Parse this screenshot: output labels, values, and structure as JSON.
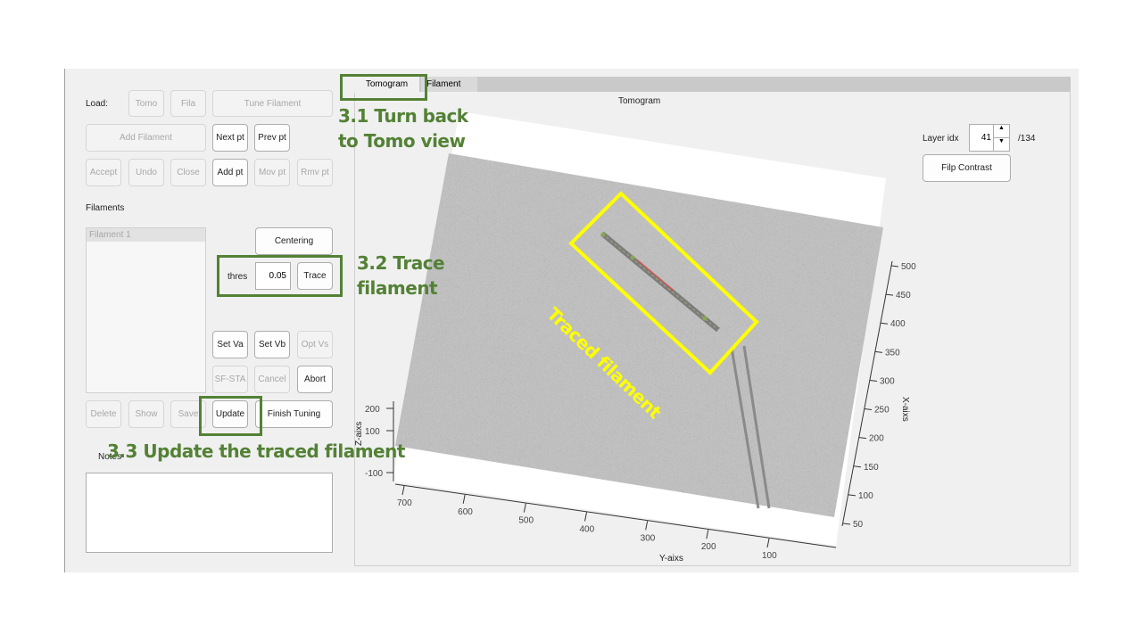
{
  "load_panel": {
    "load_label": "Load:",
    "tomo": "Tomo",
    "fila": "Fila",
    "tune_filament": "Tune Filament",
    "add_filament": "Add Filament",
    "next_pt": "Next pt",
    "prev_pt": "Prev pt",
    "accept": "Accept",
    "undo": "Undo",
    "close": "Close",
    "add_pt": "Add pt",
    "mov_pt": "Mov pt",
    "rmv_pt": "Rmv pt"
  },
  "filaments": {
    "label": "Filaments",
    "items": [
      "Filament 1"
    ],
    "centering": "Centering",
    "thres_label": "thres",
    "thres_value": "0.05",
    "trace": "Trace",
    "set_va": "Set Va",
    "set_vb": "Set Vb",
    "opt_vs": "Opt Vs",
    "sf_sta": "SF-STA",
    "cancel": "Cancel",
    "abort": "Abort",
    "delete": "Delete",
    "show": "Show",
    "save": "Save",
    "update": "Update",
    "finish_tuning": "Finish Tuning"
  },
  "notes": {
    "label": "Notes",
    "value": ""
  },
  "tabs": [
    {
      "label": "Tomogram",
      "active": true
    },
    {
      "label": "Filament",
      "active": false
    }
  ],
  "tomogram": {
    "title": "Tomogram",
    "layer_label": "Layer idx",
    "layer_value": "41",
    "layer_total": "/134",
    "flip_contrast": "Filp Contrast",
    "x_axis": {
      "label": "X-aixs",
      "ticks": [
        "500",
        "450",
        "400",
        "350",
        "300",
        "250",
        "200",
        "150",
        "100",
        "50"
      ]
    },
    "y_axis": {
      "label": "Y-aixs",
      "ticks": [
        "700",
        "600",
        "500",
        "400",
        "300",
        "200",
        "100"
      ]
    },
    "z_axis": {
      "label": "Z-aixs",
      "ticks": [
        "200",
        "100",
        "-100"
      ]
    }
  },
  "annotations": {
    "step1_line1": "3.1 Turn back",
    "step1_line2": "to Tomo view",
    "step2_line1": "3.2 Trace",
    "step2_line2": "filament",
    "step3": "3.3 Update the traced filament",
    "traced_label": "Traced filament",
    "green": "#538135",
    "yellow": "#ffff00"
  }
}
